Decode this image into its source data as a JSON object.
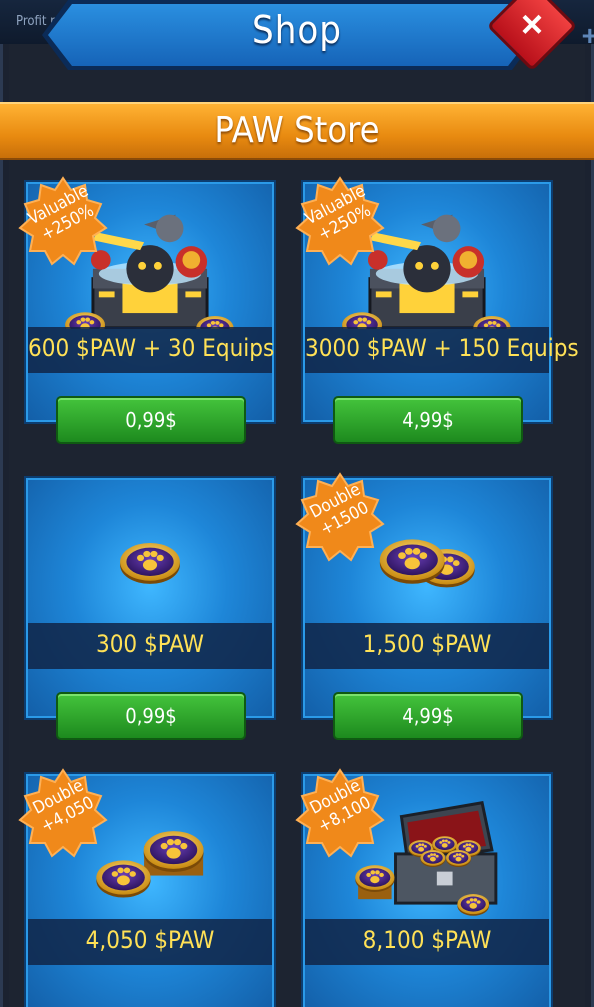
{
  "top_bar": {
    "profit_text": "Profit r",
    "plus_icon": "+"
  },
  "header": {
    "title": "Shop",
    "close_icon": "×"
  },
  "store": {
    "title": "PAW Store"
  },
  "cards": [
    {
      "label": "600 $PAW + 30 Equips",
      "price": "0,99$",
      "badge_line1": "Valuable",
      "badge_line2": "+250%",
      "image": "chest-with-paw-coins-icon"
    },
    {
      "label": "3000 $PAW + 150 Equips",
      "price": "4,99$",
      "badge_line1": "Valuable",
      "badge_line2": "+250%",
      "image": "chest-with-paw-coins-icon"
    },
    {
      "label": "300 $PAW",
      "price": "0,99$",
      "image": "single-paw-coin-icon"
    },
    {
      "label": "1,500 $PAW",
      "price": "4,99$",
      "badge_line1": "Double",
      "badge_line2": "+1500",
      "image": "two-paw-coins-icon"
    },
    {
      "label": "4,050 $PAW",
      "badge_line1": "Double",
      "badge_line2": "+4,050",
      "image": "paw-coin-stacks-icon"
    },
    {
      "label": "8,100 $PAW",
      "badge_line1": "Double",
      "badge_line2": "+8,100",
      "image": "paw-coin-case-icon"
    }
  ],
  "colors": {
    "accent_orange": "#f29a1a",
    "card_blue": "#1e86d8",
    "label_yellow": "#ffe156",
    "button_green": "#2da52a",
    "close_red": "#d8202a"
  }
}
